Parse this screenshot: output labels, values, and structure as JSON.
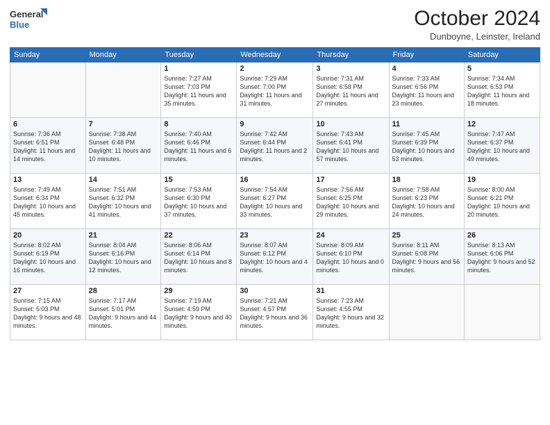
{
  "logo": {
    "line1": "General",
    "line2": "Blue"
  },
  "title": "October 2024",
  "location": "Dunboyne, Leinster, Ireland",
  "days_of_week": [
    "Sunday",
    "Monday",
    "Tuesday",
    "Wednesday",
    "Thursday",
    "Friday",
    "Saturday"
  ],
  "weeks": [
    [
      {
        "day": "",
        "info": ""
      },
      {
        "day": "",
        "info": ""
      },
      {
        "day": "1",
        "info": "Sunrise: 7:27 AM\nSunset: 7:03 PM\nDaylight: 11 hours and 35 minutes."
      },
      {
        "day": "2",
        "info": "Sunrise: 7:29 AM\nSunset: 7:00 PM\nDaylight: 11 hours and 31 minutes."
      },
      {
        "day": "3",
        "info": "Sunrise: 7:31 AM\nSunset: 6:58 PM\nDaylight: 11 hours and 27 minutes."
      },
      {
        "day": "4",
        "info": "Sunrise: 7:33 AM\nSunset: 6:56 PM\nDaylight: 11 hours and 23 minutes."
      },
      {
        "day": "5",
        "info": "Sunrise: 7:34 AM\nSunset: 6:53 PM\nDaylight: 11 hours and 18 minutes."
      }
    ],
    [
      {
        "day": "6",
        "info": "Sunrise: 7:36 AM\nSunset: 6:51 PM\nDaylight: 11 hours and 14 minutes."
      },
      {
        "day": "7",
        "info": "Sunrise: 7:38 AM\nSunset: 6:48 PM\nDaylight: 11 hours and 10 minutes."
      },
      {
        "day": "8",
        "info": "Sunrise: 7:40 AM\nSunset: 6:46 PM\nDaylight: 11 hours and 6 minutes."
      },
      {
        "day": "9",
        "info": "Sunrise: 7:42 AM\nSunset: 6:44 PM\nDaylight: 11 hours and 2 minutes."
      },
      {
        "day": "10",
        "info": "Sunrise: 7:43 AM\nSunset: 6:41 PM\nDaylight: 10 hours and 57 minutes."
      },
      {
        "day": "11",
        "info": "Sunrise: 7:45 AM\nSunset: 6:39 PM\nDaylight: 10 hours and 53 minutes."
      },
      {
        "day": "12",
        "info": "Sunrise: 7:47 AM\nSunset: 6:37 PM\nDaylight: 10 hours and 49 minutes."
      }
    ],
    [
      {
        "day": "13",
        "info": "Sunrise: 7:49 AM\nSunset: 6:34 PM\nDaylight: 10 hours and 45 minutes."
      },
      {
        "day": "14",
        "info": "Sunrise: 7:51 AM\nSunset: 6:32 PM\nDaylight: 10 hours and 41 minutes."
      },
      {
        "day": "15",
        "info": "Sunrise: 7:53 AM\nSunset: 6:30 PM\nDaylight: 10 hours and 37 minutes."
      },
      {
        "day": "16",
        "info": "Sunrise: 7:54 AM\nSunset: 6:27 PM\nDaylight: 10 hours and 33 minutes."
      },
      {
        "day": "17",
        "info": "Sunrise: 7:56 AM\nSunset: 6:25 PM\nDaylight: 10 hours and 29 minutes."
      },
      {
        "day": "18",
        "info": "Sunrise: 7:58 AM\nSunset: 6:23 PM\nDaylight: 10 hours and 24 minutes."
      },
      {
        "day": "19",
        "info": "Sunrise: 8:00 AM\nSunset: 6:21 PM\nDaylight: 10 hours and 20 minutes."
      }
    ],
    [
      {
        "day": "20",
        "info": "Sunrise: 8:02 AM\nSunset: 6:19 PM\nDaylight: 10 hours and 16 minutes."
      },
      {
        "day": "21",
        "info": "Sunrise: 8:04 AM\nSunset: 6:16 PM\nDaylight: 10 hours and 12 minutes."
      },
      {
        "day": "22",
        "info": "Sunrise: 8:06 AM\nSunset: 6:14 PM\nDaylight: 10 hours and 8 minutes."
      },
      {
        "day": "23",
        "info": "Sunrise: 8:07 AM\nSunset: 6:12 PM\nDaylight: 10 hours and 4 minutes."
      },
      {
        "day": "24",
        "info": "Sunrise: 8:09 AM\nSunset: 6:10 PM\nDaylight: 10 hours and 0 minutes."
      },
      {
        "day": "25",
        "info": "Sunrise: 8:11 AM\nSunset: 6:08 PM\nDaylight: 9 hours and 56 minutes."
      },
      {
        "day": "26",
        "info": "Sunrise: 8:13 AM\nSunset: 6:06 PM\nDaylight: 9 hours and 52 minutes."
      }
    ],
    [
      {
        "day": "27",
        "info": "Sunrise: 7:15 AM\nSunset: 5:03 PM\nDaylight: 9 hours and 48 minutes."
      },
      {
        "day": "28",
        "info": "Sunrise: 7:17 AM\nSunset: 5:01 PM\nDaylight: 9 hours and 44 minutes."
      },
      {
        "day": "29",
        "info": "Sunrise: 7:19 AM\nSunset: 4:59 PM\nDaylight: 9 hours and 40 minutes."
      },
      {
        "day": "30",
        "info": "Sunrise: 7:21 AM\nSunset: 4:57 PM\nDaylight: 9 hours and 36 minutes."
      },
      {
        "day": "31",
        "info": "Sunrise: 7:23 AM\nSunset: 4:55 PM\nDaylight: 9 hours and 32 minutes."
      },
      {
        "day": "",
        "info": ""
      },
      {
        "day": "",
        "info": ""
      }
    ]
  ]
}
